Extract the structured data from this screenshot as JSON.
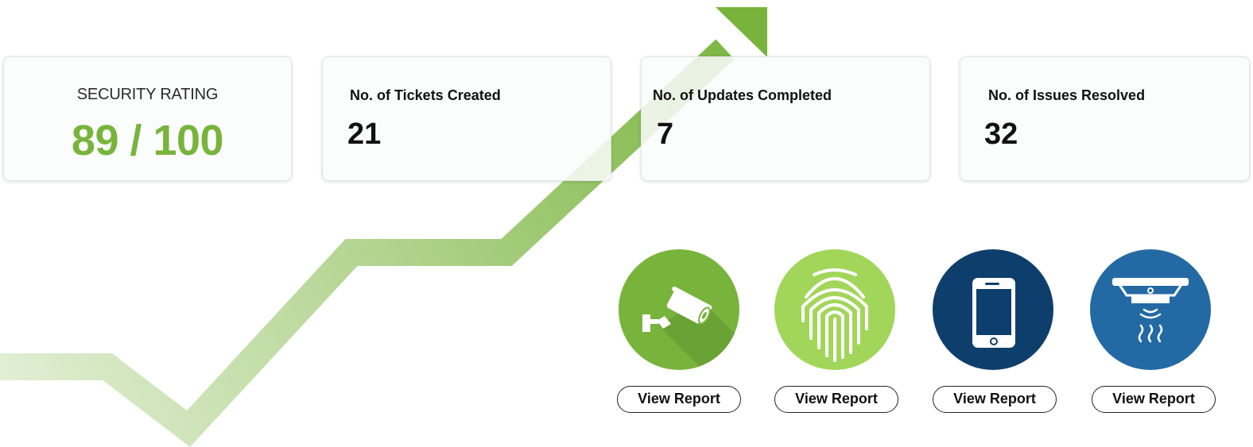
{
  "colors": {
    "accent_green": "#78b43c",
    "light_green": "#a2d65a",
    "navy": "#0e3f6c",
    "blue": "#236aa4"
  },
  "security_rating": {
    "title": "SECURITY RATING",
    "value": "89 / 100"
  },
  "metrics": [
    {
      "label": "No. of Tickets Created",
      "value": "21"
    },
    {
      "label": "No. of Updates Completed",
      "value": "7"
    },
    {
      "label": "No. of Issues Resolved",
      "value": "32"
    }
  ],
  "devices": [
    {
      "icon": "security-camera-icon",
      "button_label": "View Report"
    },
    {
      "icon": "fingerprint-icon",
      "button_label": "View Report"
    },
    {
      "icon": "smartphone-icon",
      "button_label": "View Report"
    },
    {
      "icon": "smoke-detector-icon",
      "button_label": "View Report"
    }
  ]
}
